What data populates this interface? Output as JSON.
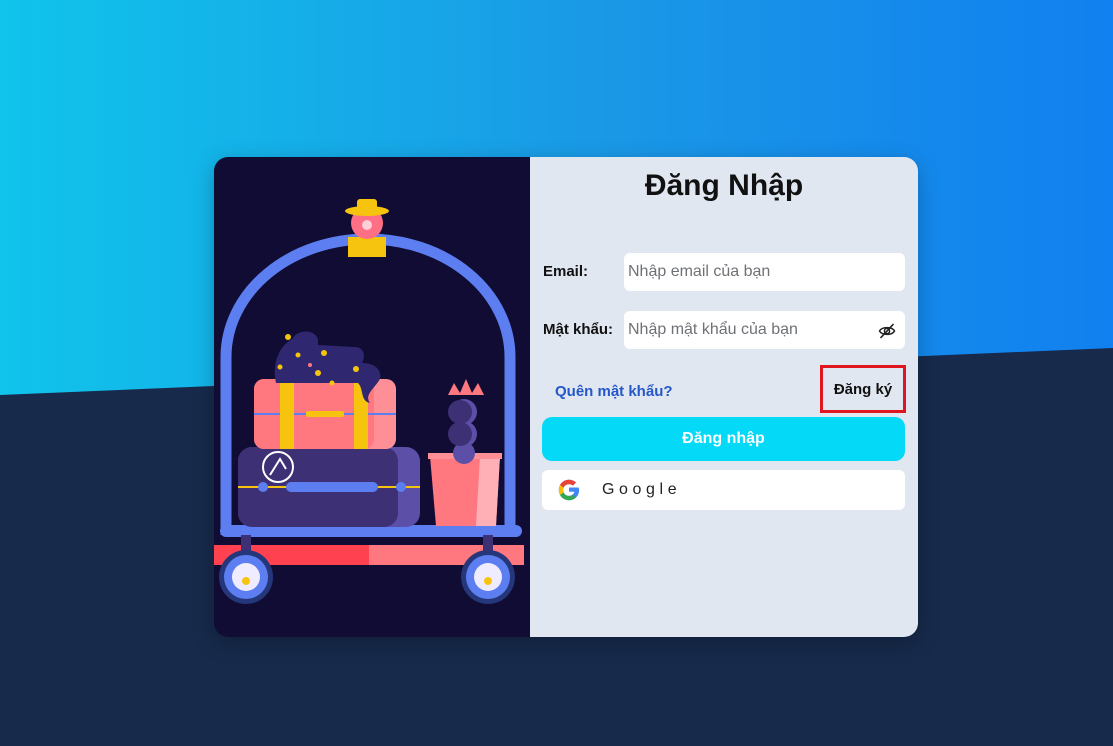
{
  "login": {
    "title": "Đăng Nhập",
    "email_label": "Email:",
    "email_placeholder": "Nhập email của bạn",
    "password_label": "Mật khẩu:",
    "password_placeholder": "Nhập mật khẩu của bạn",
    "forgot_password": "Quên mật khẩu?",
    "register": "Đăng ký",
    "login_button": "Đăng nhập",
    "google_button": "Google"
  },
  "icons": {
    "password_toggle": "eye-slash-icon",
    "google": "google-logo-icon"
  },
  "colors": {
    "background_top": "#10c4eb",
    "background_bottom": "#172a4b",
    "illustration_bg": "#110c33",
    "form_bg": "#e1e7f0",
    "login_button": "#04d9f7",
    "link": "#2457c8",
    "highlight_border": "#e0161e"
  }
}
